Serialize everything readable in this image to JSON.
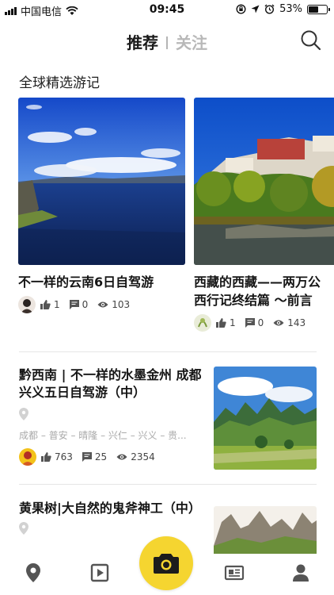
{
  "status_bar": {
    "carrier": "中国电信",
    "time": "09:45",
    "battery": "53%",
    "battery_level": 0.53
  },
  "header": {
    "tab_recommend": "推荐",
    "tab_follow": "关注",
    "search_icon": "search-icon"
  },
  "section": {
    "title": "全球精选游记"
  },
  "featured": [
    {
      "title": "不一样的云南6日自驾游",
      "likes": "1",
      "comments": "0",
      "views": "103"
    },
    {
      "title": "西藏的西藏——两万公",
      "title_line2": "西行记终结篇 ～前言",
      "likes": "1",
      "comments": "0",
      "views": "143"
    }
  ],
  "list": [
    {
      "title": "黔西南 | 不一样的水墨金州 成都兴义五日自驾游（中）",
      "route": "成都 – 普安 – 晴隆 – 兴仁 – 兴义 – 贵...",
      "likes": "763",
      "comments": "25",
      "views": "2354"
    },
    {
      "title": "黄果树|大自然的鬼斧神工（中）"
    }
  ],
  "bottom_nav": {
    "items": [
      "location-icon",
      "video-icon",
      "camera-icon",
      "news-icon",
      "profile-icon"
    ],
    "accent": "#f5d530"
  }
}
